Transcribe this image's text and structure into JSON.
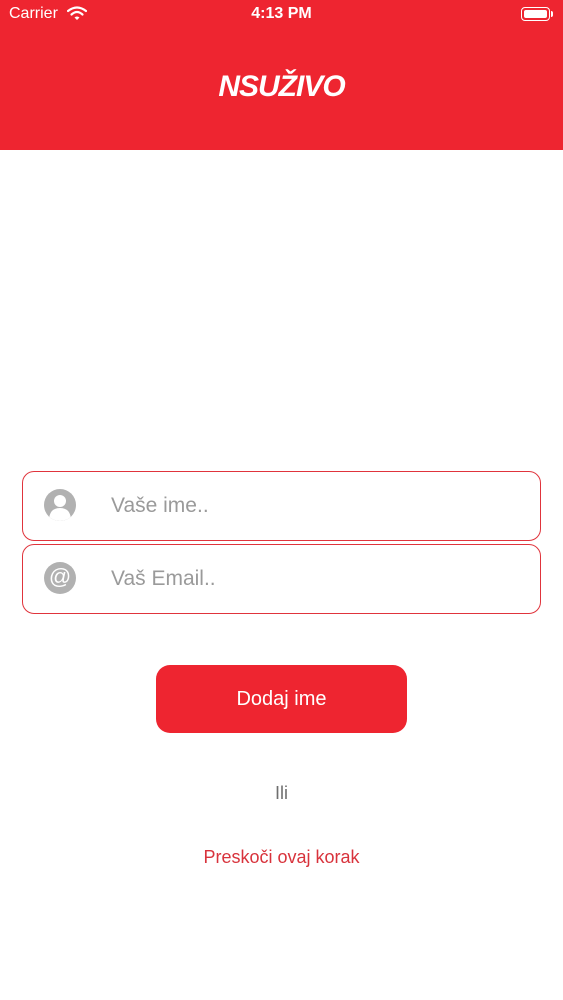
{
  "status_bar": {
    "carrier": "Carrier",
    "time": "4:13 PM",
    "wifi_icon": "wifi-icon",
    "battery_icon": "battery-icon"
  },
  "header": {
    "logo_text": "NSUŽIVO",
    "background_color": "#ee2530"
  },
  "form": {
    "name_field": {
      "placeholder": "Vaše ime..",
      "value": "",
      "icon": "user-icon"
    },
    "email_field": {
      "placeholder": "Vaš Email..",
      "value": "",
      "icon": "at-sign-icon"
    },
    "submit_label": "Dodaj ime",
    "or_text": "Ili",
    "skip_label": "Preskoči ovaj korak",
    "accent_color": "#ee2530"
  }
}
